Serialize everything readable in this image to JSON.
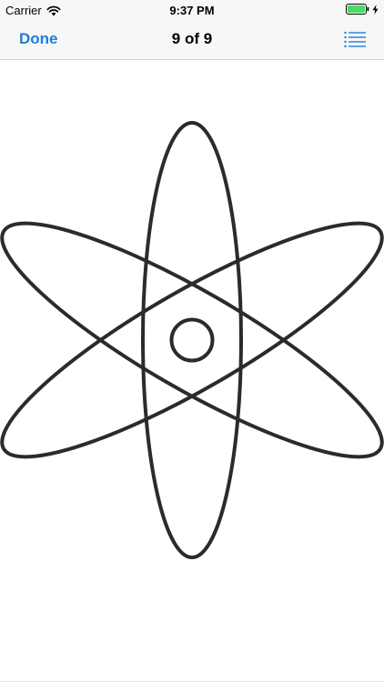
{
  "status_bar": {
    "carrier": "Carrier",
    "time": "9:37 PM",
    "wifi_icon": "wifi-icon",
    "battery_icon": "battery-icon",
    "charging_icon": "charging-bolt-icon",
    "battery_color": "#4cd964"
  },
  "nav": {
    "done_label": "Done",
    "title": "9 of 9",
    "list_icon": "list-icon",
    "accent_color": "#1a7fd6"
  },
  "content": {
    "image_icon": "atom-icon",
    "stroke_color": "#2b2b2b"
  }
}
